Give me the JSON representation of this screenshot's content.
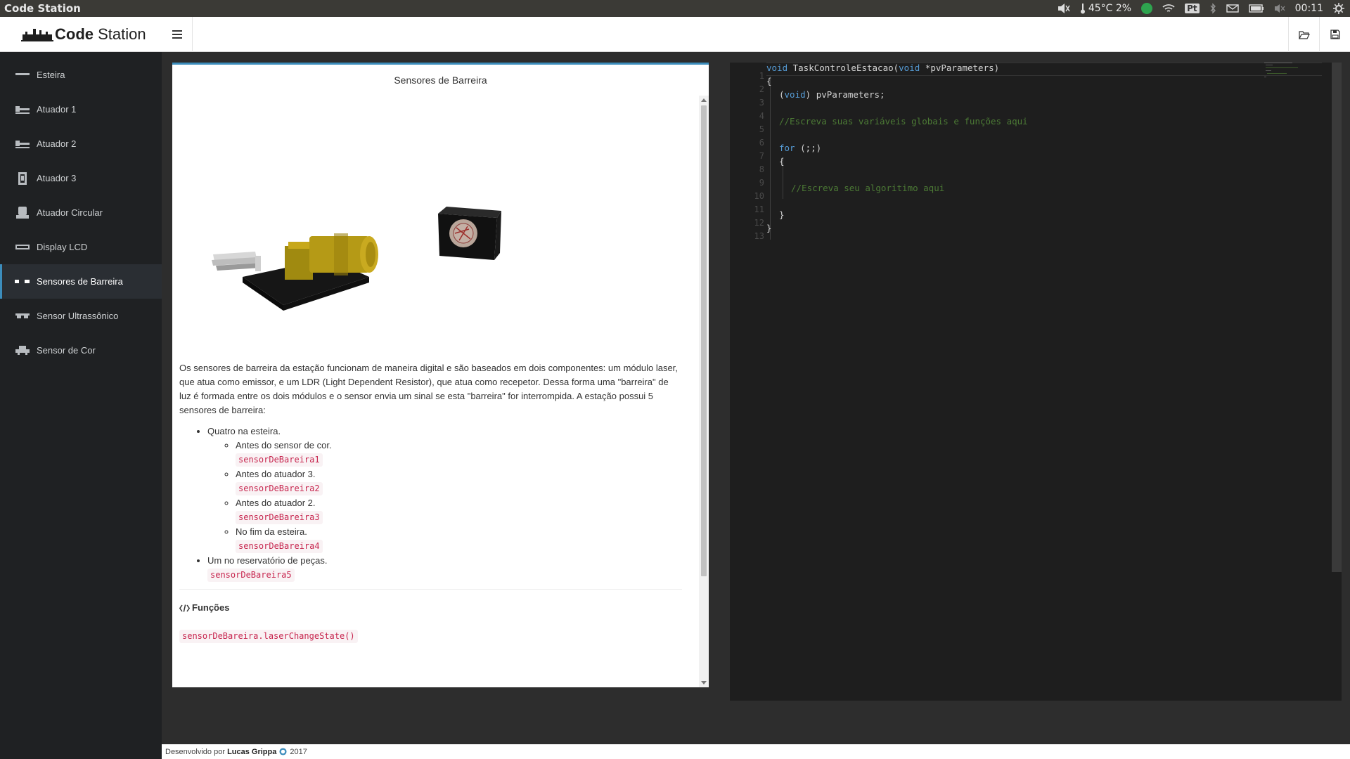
{
  "os_bar": {
    "title": "Code Station",
    "temperature": "45°C 2%",
    "keyboard": "Pt",
    "time": "00:11"
  },
  "header": {
    "brand_bold": "Code",
    "brand_rest": " Station"
  },
  "sidebar": {
    "items": [
      {
        "label": "Esteira",
        "icon": "conveyor-icon"
      },
      {
        "label": "Atuador 1",
        "icon": "actuator-icon"
      },
      {
        "label": "Atuador 2",
        "icon": "actuator-icon"
      },
      {
        "label": "Atuador 3",
        "icon": "vertical-actuator-icon"
      },
      {
        "label": "Atuador Circular",
        "icon": "circular-actuator-icon"
      },
      {
        "label": "Display LCD",
        "icon": "lcd-display-icon"
      },
      {
        "label": "Sensores de Barreira",
        "icon": "barrier-sensor-icon"
      },
      {
        "label": "Sensor Ultrassônico",
        "icon": "ultrasonic-sensor-icon"
      },
      {
        "label": "Sensor de Cor",
        "icon": "color-sensor-icon"
      }
    ],
    "active_index": 6
  },
  "doc": {
    "title": "Sensores de Barreira",
    "intro": "Os sensores de barreira da estação funcionam de maneira digital e são baseados em dois componentes: um módulo laser, que atua como emissor, e um LDR (Light Dependent Resistor), que atua como recepetor. Dessa forma uma \"barreira\" de luz é formada entre os dois módulos e o sensor envia um sinal se esta \"barreira\" for interrompida. A estação possui 5 sensores de barreira:",
    "list": {
      "item1": "Quatro na esteira.",
      "sub": [
        {
          "text": "Antes do sensor de cor.",
          "code": "sensorDeBareira1"
        },
        {
          "text": "Antes do atuador 3.",
          "code": "sensorDeBareira2"
        },
        {
          "text": "Antes do atuador 2.",
          "code": "sensorDeBareira3"
        },
        {
          "text": "No fim da esteira.",
          "code": "sensorDeBareira4"
        }
      ],
      "item2": "Um no reservatório de peças.",
      "item2_code": "sensorDeBareira5"
    },
    "functions_heading": "Funções",
    "function_code": "sensorDeBareira.laserChangeState()"
  },
  "editor": {
    "line_numbers": [
      "1",
      "2",
      "3",
      "4",
      "5",
      "6",
      "7",
      "8",
      "9",
      "10",
      "11",
      "12",
      "13"
    ],
    "signature_kw1": "void",
    "signature_name": " TaskControleEstacao(",
    "signature_kw2": "void",
    "signature_rest": " *pvParameters)",
    "open_brace": "{",
    "cast_kw": "void",
    "cast_rest": " pvParameters;",
    "comment1": "//Escreva suas variáveis globais e funções aqui",
    "for_kw": "for",
    "for_rest": " (;;)",
    "inner_open": "{",
    "comment2": "//Escreva seu algoritimo aqui",
    "inner_close": "}",
    "close_brace": "}"
  },
  "footer": {
    "prefix": "Desenvolvido por",
    "author": "Lucas Grippa",
    "year": "2017"
  }
}
